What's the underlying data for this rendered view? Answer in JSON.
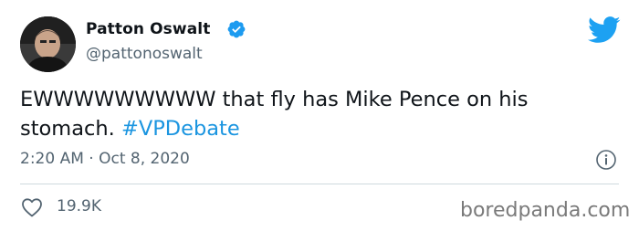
{
  "author": {
    "display_name": "Patton Oswalt",
    "handle": "@pattonoswalt",
    "verified": true
  },
  "tweet": {
    "text": "EWWWWWWWWW that fly has Mike Pence on his stomach.",
    "hashtag": "#VPDebate",
    "timestamp": "2:20 AM · Oct 8, 2020"
  },
  "engagement": {
    "likes": "19.9K"
  },
  "icons": {
    "avatar": "avatar",
    "verified": "verified-badge-icon",
    "logo": "twitter-bird-icon",
    "info": "info-icon",
    "like": "heart-icon"
  },
  "watermark": "boredpanda.com",
  "colors": {
    "brand_blue": "#1da1f2",
    "hashtag": "#1b95e0",
    "secondary_text": "#536471",
    "primary_text": "#0f1419"
  }
}
